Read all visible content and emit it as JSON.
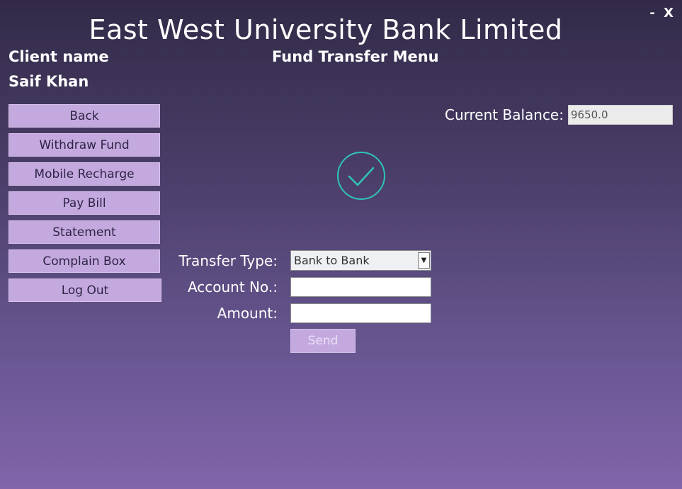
{
  "app": {
    "title": "East West University Bank Limited",
    "minimize": "-",
    "close": "X"
  },
  "client": {
    "label": "Client name",
    "name": "Saif Khan"
  },
  "menu_title": "Fund Transfer Menu",
  "sidebar": {
    "buttons": [
      "Back",
      "Withdraw Fund",
      "Mobile Recharge",
      "Pay Bill",
      "Statement",
      "Complain Box",
      "Log Out"
    ]
  },
  "balance": {
    "label": "Current Balance:",
    "value": "9650.0"
  },
  "form": {
    "transfer_type_label": "Transfer Type:",
    "transfer_type_value": "Bank to Bank",
    "account_label": "Account No.:",
    "account_value": "",
    "amount_label": "Amount:",
    "amount_value": "",
    "send_label": "Send"
  },
  "colors": {
    "button_bg": "#c4a9df",
    "accent_check": "#2ec4b6"
  },
  "icons": {
    "status": "checkmark-circle-icon",
    "dropdown": "chevron-down-icon"
  }
}
